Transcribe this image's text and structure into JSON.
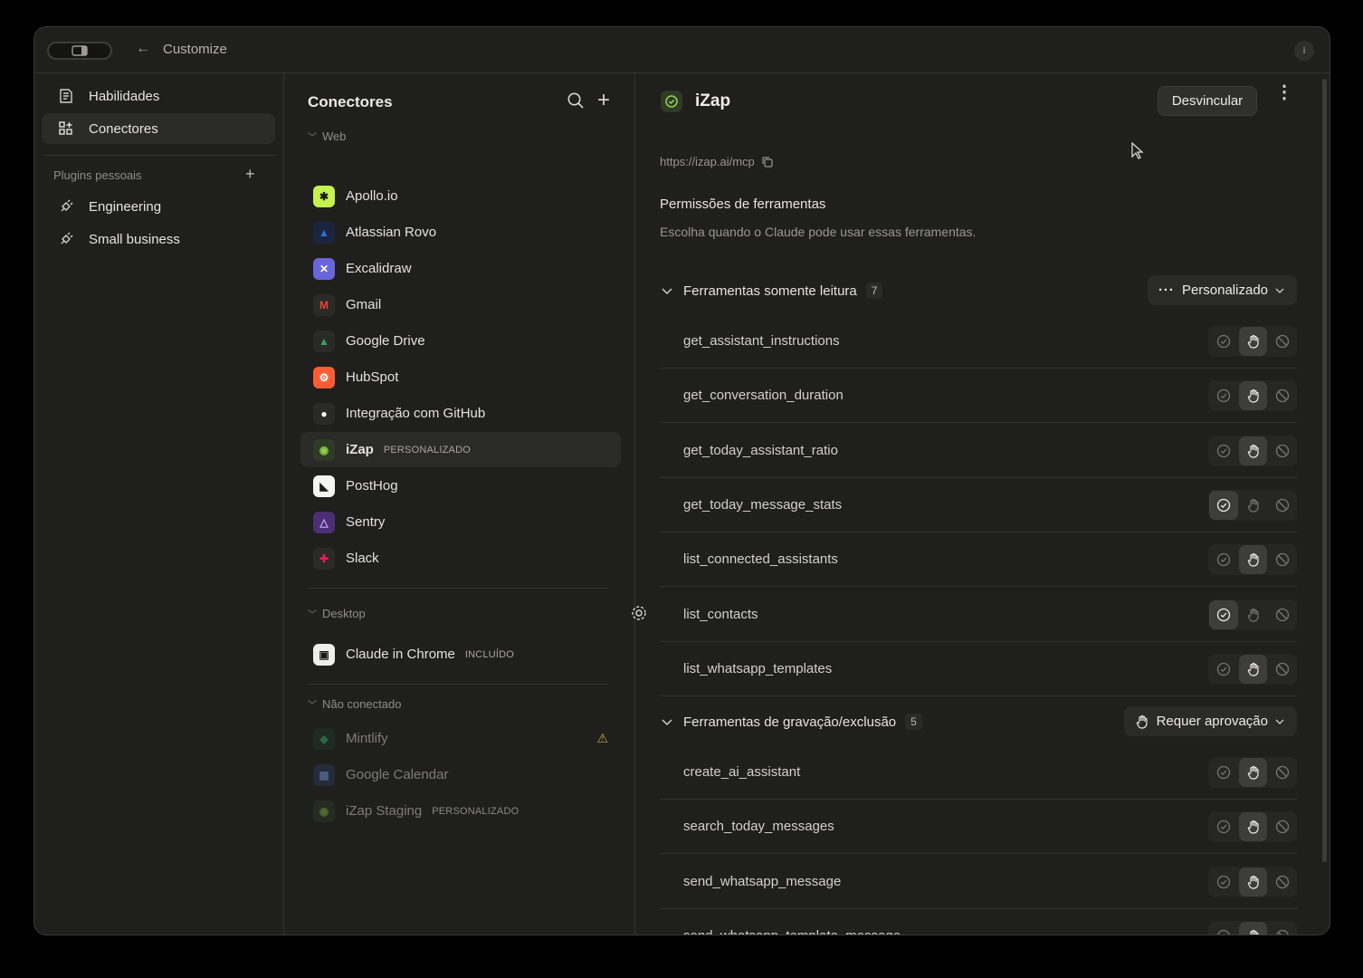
{
  "window": {
    "title": "Customize"
  },
  "sidebar": {
    "items": [
      {
        "label": "Habilidades",
        "icon": "skills-icon"
      },
      {
        "label": "Conectores",
        "icon": "connectors-icon",
        "active": true
      }
    ],
    "plugins_header": "Plugins pessoais",
    "plugins": [
      {
        "label": "Engineering",
        "icon": "plug-icon"
      },
      {
        "label": "Small business",
        "icon": "plug-icon"
      }
    ]
  },
  "connectors": {
    "title": "Conectores",
    "groups": {
      "web": "Web",
      "desktop": "Desktop",
      "not_connected": "Não conectado"
    },
    "web_items": [
      {
        "label": "Apollo.io",
        "icon": "apollo-icon",
        "color": "#c6f24e"
      },
      {
        "label": "Atlassian Rovo",
        "icon": "atlassian-icon",
        "color": "#2f6fe4"
      },
      {
        "label": "Excalidraw",
        "icon": "excalidraw-icon",
        "color": "#6965db"
      },
      {
        "label": "Gmail",
        "icon": "gmail-icon",
        "color": "#ea4335"
      },
      {
        "label": "Google Drive",
        "icon": "google-drive-icon",
        "color": "#34a853"
      },
      {
        "label": "HubSpot",
        "icon": "hubspot-icon",
        "color": "#ff5c35"
      },
      {
        "label": "Integração com GitHub",
        "icon": "github-icon",
        "color": "#ffffff"
      },
      {
        "label": "iZap",
        "icon": "izap-icon",
        "color": "#7dbb3c",
        "tag": "PERSONALIZADO",
        "active": true
      },
      {
        "label": "PostHog",
        "icon": "posthog-icon",
        "color": "#ffffff"
      },
      {
        "label": "Sentry",
        "icon": "sentry-icon",
        "color": "#8c5cd6"
      },
      {
        "label": "Slack",
        "icon": "slack-icon",
        "color": "#e01e5a"
      }
    ],
    "desktop_items": [
      {
        "label": "Claude in Chrome",
        "icon": "chrome-extension-icon",
        "tag": "INCLUÍDO"
      }
    ],
    "not_connected_items": [
      {
        "label": "Mintlify",
        "icon": "mintlify-icon",
        "warning": true
      },
      {
        "label": "Google Calendar",
        "icon": "google-calendar-icon"
      },
      {
        "label": "iZap Staging",
        "icon": "izap-icon",
        "tag": "PERSONALIZADO"
      }
    ]
  },
  "detail": {
    "title": "iZap",
    "unlink_label": "Desvincular",
    "url": "https://izap.ai/mcp",
    "permissions_title": "Permissões de ferramentas",
    "permissions_desc": "Escolha quando o Claude pode usar essas ferramentas.",
    "read_only": {
      "label": "Ferramentas somente leitura",
      "count": "7",
      "mode": "Personalizado",
      "tools": [
        {
          "name": "get_assistant_instructions",
          "state": "ask"
        },
        {
          "name": "get_conversation_duration",
          "state": "ask"
        },
        {
          "name": "get_today_assistant_ratio",
          "state": "ask"
        },
        {
          "name": "get_today_message_stats",
          "state": "allow"
        },
        {
          "name": "list_connected_assistants",
          "state": "ask"
        },
        {
          "name": "list_contacts",
          "state": "allow"
        },
        {
          "name": "list_whatsapp_templates",
          "state": "ask"
        }
      ]
    },
    "write": {
      "label": "Ferramentas de gravação/exclusão",
      "count": "5",
      "mode": "Requer aprovação",
      "tools": [
        {
          "name": "create_ai_assistant",
          "state": "ask"
        },
        {
          "name": "search_today_messages",
          "state": "ask"
        },
        {
          "name": "send_whatsapp_message",
          "state": "ask"
        },
        {
          "name": "send_whatsapp_template_message",
          "state": "ask"
        }
      ]
    }
  }
}
